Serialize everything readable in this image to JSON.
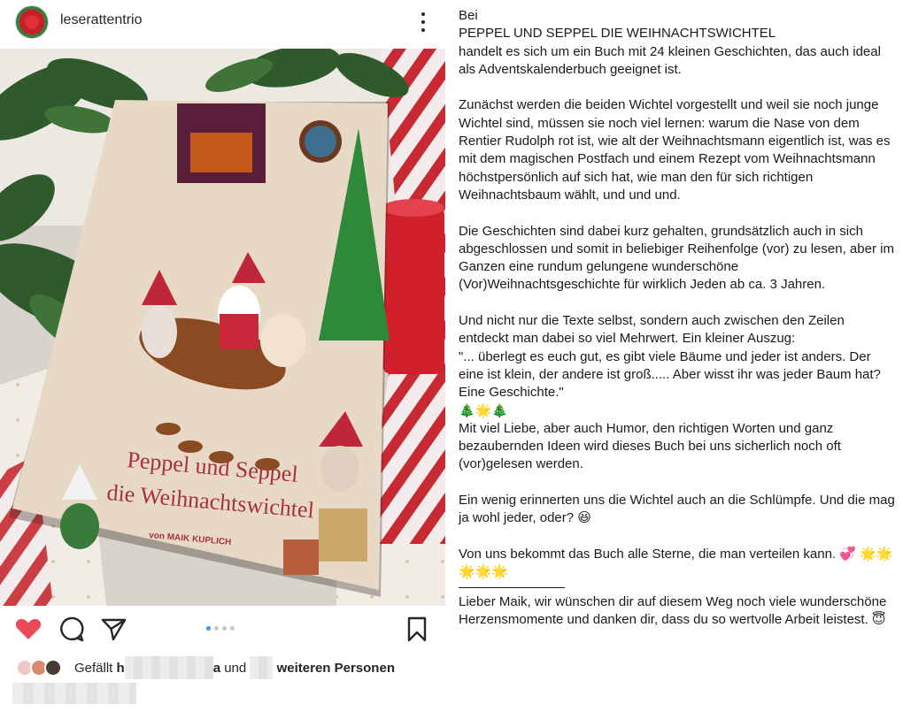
{
  "post": {
    "username": "leserattentrio",
    "carousel": {
      "count": 4,
      "active": 1
    },
    "likes": {
      "prefix": "Gefällt",
      "name_partial_1": "h",
      "name_partial_2": "a",
      "and": "und",
      "suffix": "weiteren Personen"
    }
  },
  "book": {
    "title_line1": "Peppel und Seppel",
    "title_line2": "die Weihnachtswichtel",
    "author": "von MAIK KUPLICH"
  },
  "caption": {
    "paragraphs": [
      "Bei\nPEPPEL UND SEPPEL DIE WEIHNACHTSWICHTEL\nhandelt es sich um ein Buch mit 24 kleinen Geschichten, das auch ideal als Adventskalenderbuch geeignet ist.",
      "Zunächst werden die beiden Wichtel vorgestellt und weil sie noch junge Wichtel sind, müssen sie noch viel lernen: warum die Nase von dem Rentier Rudolph rot ist, wie alt der Weihnachtsmann eigentlich ist, was es mit dem magischen Postfach und einem Rezept vom Weihnachtsmann höchstpersönlich auf sich hat, wie man den für sich richtigen Weihnachtsbaum wählt, und und und.",
      "Die Geschichten sind dabei kurz gehalten, grundsätzlich auch in sich abgeschlossen und somit in beliebiger Reihenfolge (vor) zu lesen, aber im Ganzen eine rundum gelungene wunderschöne (Vor)Weihnachtsgeschichte für wirklich Jeden ab ca. 3 Jahren.",
      "Und nicht nur die Texte selbst, sondern auch zwischen den Zeilen entdeckt man dabei so viel Mehrwert. Ein kleiner Auszug:\n\"... überlegt es euch gut, es gibt viele Bäume und jeder ist anders. Der eine ist klein, der andere ist groß..... Aber wisst ihr was jeder Baum hat? Eine Geschichte.\"\n🎄🌟🎄\nMit viel Liebe, aber auch Humor, den richtigen Worten und ganz bezaubernden Ideen wird dieses Buch  bei uns sicherlich noch oft (vor)gelesen werden.",
      "Ein wenig erinnerten uns die Wichtel auch an die Schlümpfe. Und die mag ja wohl jeder, oder? 😆",
      "Von uns bekommt das Buch alle Sterne, die man verteilen kann. 💞 🌟🌟🌟🌟🌟"
    ],
    "closing": "Lieber Maik, wir wünschen dir auf diesem Weg noch viele wunderschöne Herzensmomente und danken dir, dass du so wertvolle Arbeit leistest. 😇"
  },
  "icons": {
    "like": "heart-icon",
    "comment": "comment-icon",
    "share": "send-icon",
    "save": "bookmark-icon",
    "more": "more-vertical-icon"
  },
  "colors": {
    "heart": "#ed4956",
    "carousel_active": "#3897f0"
  }
}
